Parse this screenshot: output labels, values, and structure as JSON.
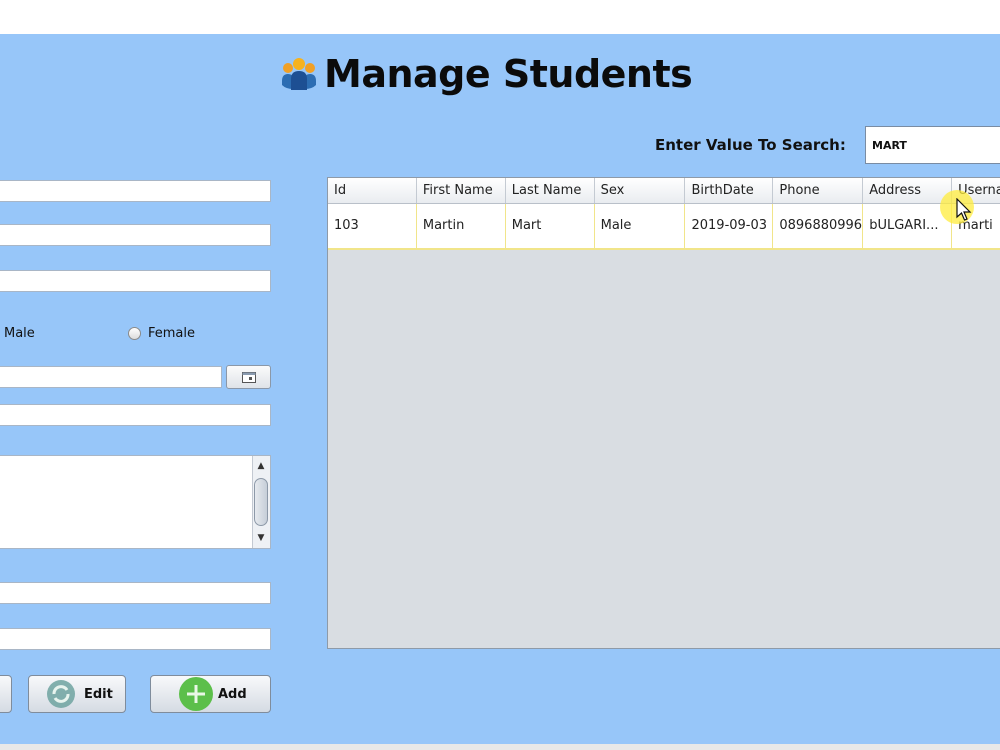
{
  "header": {
    "title": "Manage Students",
    "icon": "students-group-icon"
  },
  "search": {
    "label": "Enter Value To Search:",
    "value": "MART"
  },
  "form": {
    "sex_options": [
      {
        "label": "Male",
        "selected": false
      },
      {
        "label": "Female",
        "selected": false
      }
    ]
  },
  "buttons": {
    "edit": "Edit",
    "add": "Add"
  },
  "table": {
    "columns": [
      "Id",
      "First Name",
      "Last Name",
      "Sex",
      "BirthDate",
      "Phone",
      "Address",
      "Userna"
    ],
    "rows": [
      [
        "103",
        "Martin",
        "Mart",
        "Male",
        "2019-09-03",
        "0896880996",
        "bULGARI...",
        "marti"
      ]
    ]
  },
  "colors": {
    "background": "#97c6f9",
    "selected_row_border": "#f1e58a",
    "add_icon": "#5cbf4a"
  }
}
